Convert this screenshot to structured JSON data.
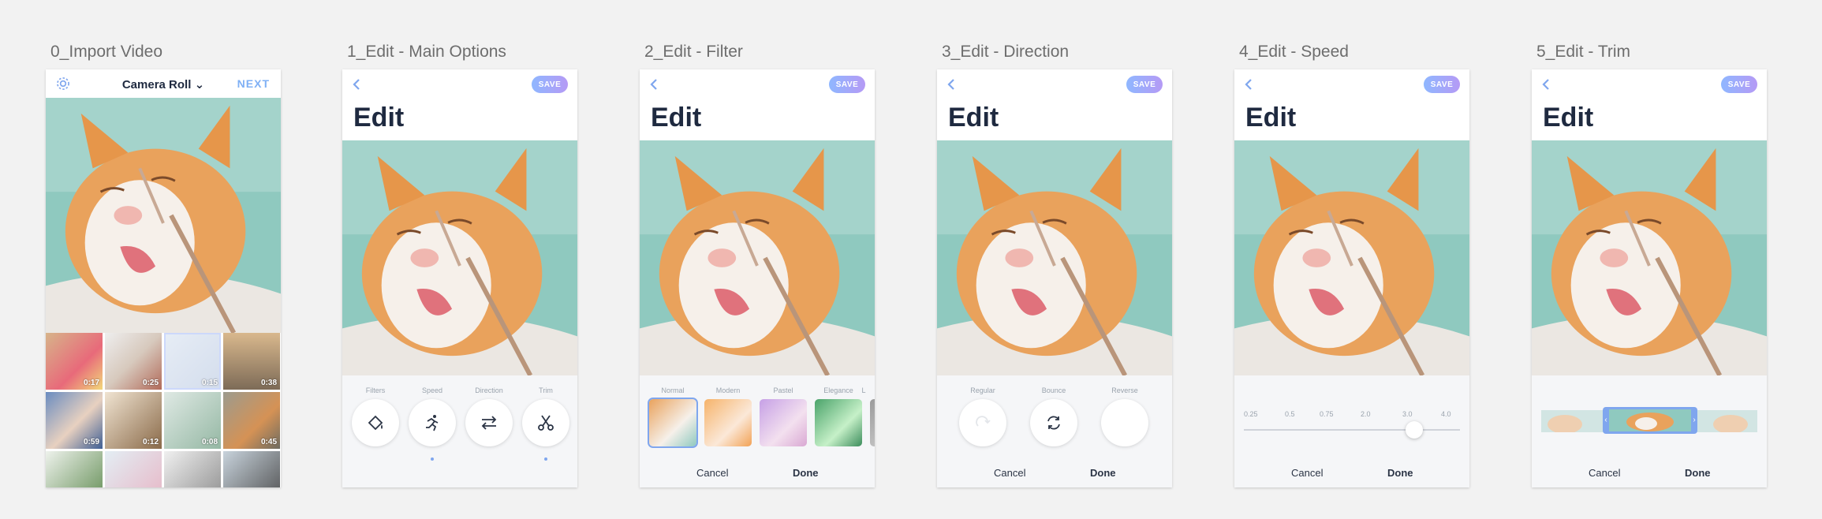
{
  "screens": [
    {
      "id": "import",
      "title": "0_Import Video"
    },
    {
      "id": "main",
      "title": "1_Edit - Main Options"
    },
    {
      "id": "filter",
      "title": "2_Edit - Filter"
    },
    {
      "id": "direction",
      "title": "3_Edit - Direction"
    },
    {
      "id": "speed",
      "title": "4_Edit - Speed"
    },
    {
      "id": "trim",
      "title": "5_Edit - Trim"
    }
  ],
  "import_screen": {
    "source_label": "Camera Roll",
    "next_label": "NEXT",
    "durations": [
      "0:17",
      "0:25",
      "0:15",
      "0:38",
      "0:59",
      "0:12",
      "0:08",
      "0:45"
    ]
  },
  "edit": {
    "title": "Edit",
    "save_label": "SAVE",
    "cancel_label": "Cancel",
    "done_label": "Done"
  },
  "main_options": [
    "Filters",
    "Speed",
    "Direction",
    "Trim"
  ],
  "filters": [
    "Normal",
    "Modern",
    "Pastel",
    "Elegance",
    "L"
  ],
  "directions": [
    "Regular",
    "Bounce",
    "Reverse"
  ],
  "speeds": [
    "0.25",
    "0.5",
    "0.75",
    "2.0",
    "3.0",
    "4.0"
  ],
  "selected_speed": "3.0",
  "colors": {
    "accent": "#7fa6ee",
    "save_gradient_start": "#8fb7ff",
    "save_gradient_end": "#b59af5",
    "title": "#1f2a40"
  }
}
